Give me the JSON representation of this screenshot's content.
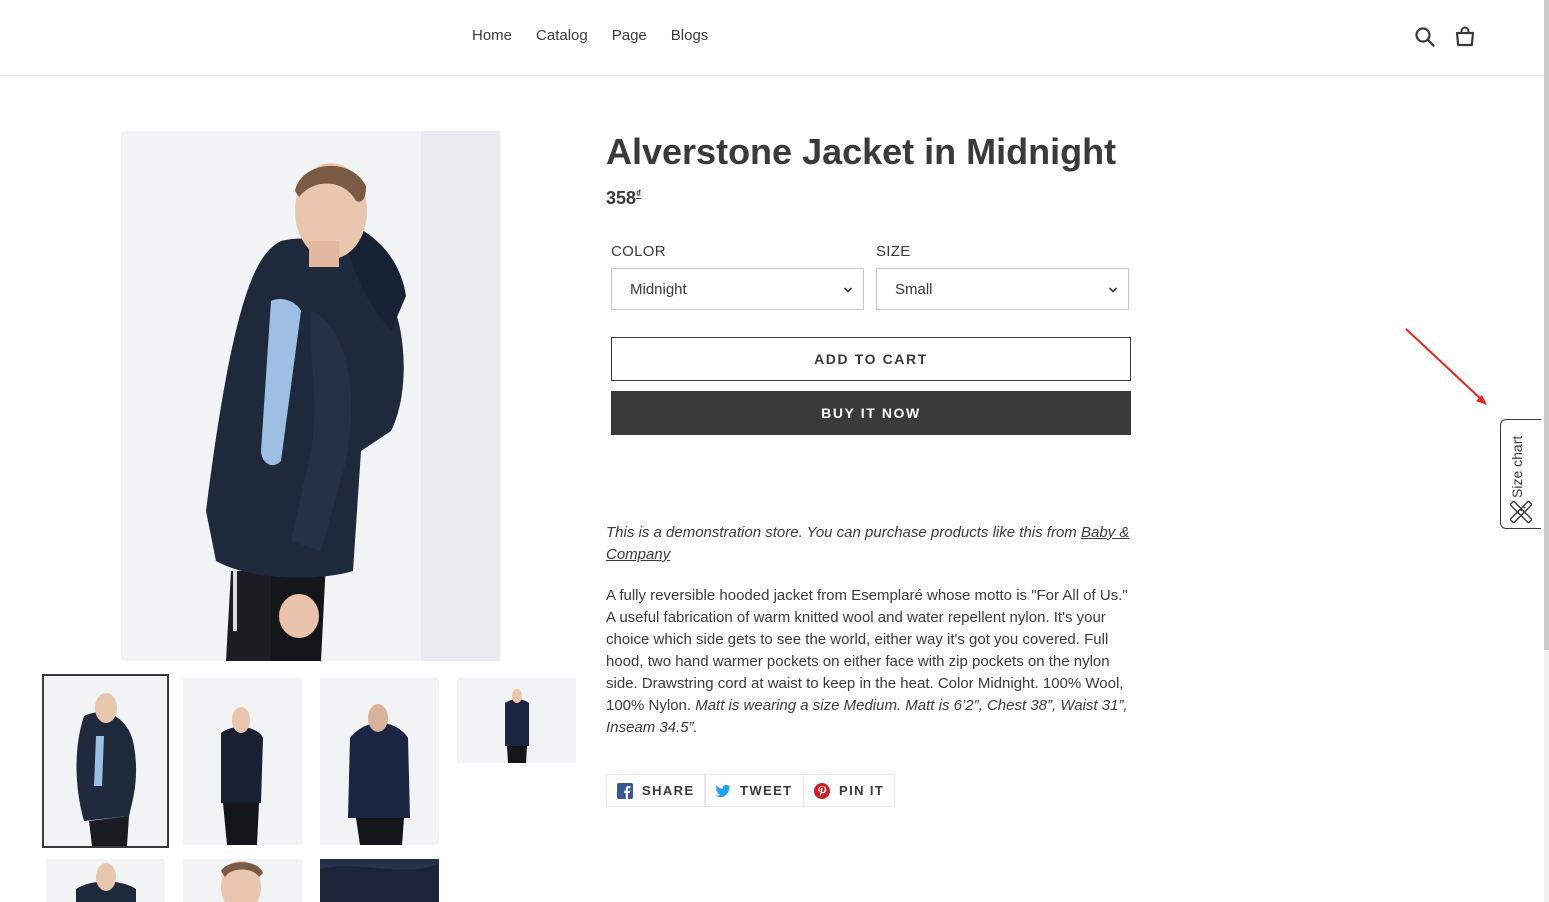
{
  "nav": {
    "items": [
      "Home",
      "Catalog",
      "Page",
      "Blogs"
    ],
    "search_icon": "search-icon",
    "cart_icon": "cart-icon"
  },
  "product": {
    "title": "Alverstone Jacket in Midnight",
    "price": "358",
    "currency_symbol": "₫",
    "options": {
      "color_label": "COLOR",
      "color_value": "Midnight",
      "size_label": "SIZE",
      "size_value": "Small"
    },
    "add_to_cart": "ADD TO CART",
    "buy_now": "BUY IT NOW",
    "demo_text": "This is a demonstration store. You can purchase products like this from ",
    "demo_link": "Baby & Company",
    "description": "A fully reversible hooded jacket from Esemplaré whose motto is \"For All of Us.\" A useful fabrication of warm knitted wool and water repellent nylon. It's your choice which side gets to see the world, either way it's got you covered. Full hood, two hand warmer pockets on either face with zip pockets on the nylon side. Drawstring cord at waist to keep in the heat. Color Midnight. 100% Wool, 100% Nylon. ",
    "description_italic": "Matt is wearing a size Medium. Matt is 6’2”, Chest 38”, Waist 31”, Inseam 34.5”."
  },
  "share": {
    "facebook": "SHARE",
    "twitter": "TWEET",
    "pinterest": "PIN IT"
  },
  "size_chart": {
    "label": "Size chart",
    "icon": "ruler-pencil-icon"
  },
  "colors": {
    "text": "#3a3a3a",
    "button_dark": "#3a3a3a",
    "border": "#e8e8e8",
    "facebook": "#3b5998",
    "twitter": "#1da1f2",
    "pinterest": "#cb2027",
    "annotation_arrow": "#e8231b"
  }
}
